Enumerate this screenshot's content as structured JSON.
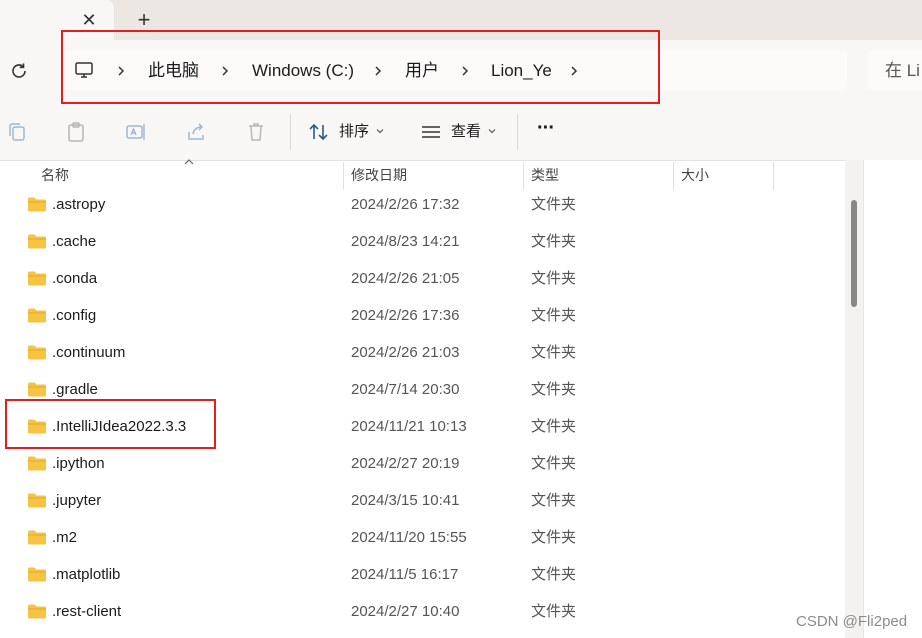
{
  "tabs": {
    "close_symbol": "✕",
    "new_tab_symbol": "+"
  },
  "nav": {
    "refresh_icon": "refresh-icon",
    "breadcrumb": [
      "此电脑",
      "Windows (C:)",
      "用户",
      "Lion_Ye"
    ],
    "search_placeholder": "在 Li"
  },
  "toolbar": {
    "copy_icon": "copy-icon",
    "paste_icon": "paste-icon",
    "rename_icon": "rename-icon",
    "share_icon": "share-icon",
    "delete_icon": "delete-icon",
    "sort_label": "排序",
    "view_label": "查看",
    "more_label": "···"
  },
  "columns": {
    "name": "名称",
    "modified": "修改日期",
    "type": "类型",
    "size": "大小"
  },
  "files": [
    {
      "name": ".astropy",
      "modified": "2024/2/26 17:32",
      "type": "文件夹"
    },
    {
      "name": ".cache",
      "modified": "2024/8/23 14:21",
      "type": "文件夹"
    },
    {
      "name": ".conda",
      "modified": "2024/2/26 21:05",
      "type": "文件夹"
    },
    {
      "name": ".config",
      "modified": "2024/2/26 17:36",
      "type": "文件夹"
    },
    {
      "name": ".continuum",
      "modified": "2024/2/26 21:03",
      "type": "文件夹"
    },
    {
      "name": ".gradle",
      "modified": "2024/7/14 20:30",
      "type": "文件夹"
    },
    {
      "name": ".IntelliJIdea2022.3.3",
      "modified": "2024/11/21 10:13",
      "type": "文件夹"
    },
    {
      "name": ".ipython",
      "modified": "2024/2/27 20:19",
      "type": "文件夹"
    },
    {
      "name": ".jupyter",
      "modified": "2024/3/15 10:41",
      "type": "文件夹"
    },
    {
      "name": ".m2",
      "modified": "2024/11/20 15:55",
      "type": "文件夹"
    },
    {
      "name": ".matplotlib",
      "modified": "2024/11/5 16:17",
      "type": "文件夹"
    },
    {
      "name": ".rest-client",
      "modified": "2024/2/27 10:40",
      "type": "文件夹"
    }
  ],
  "colors": {
    "highlight": "#e02020",
    "folder": "#f6c343"
  },
  "watermark": "CSDN @Fli2ped"
}
